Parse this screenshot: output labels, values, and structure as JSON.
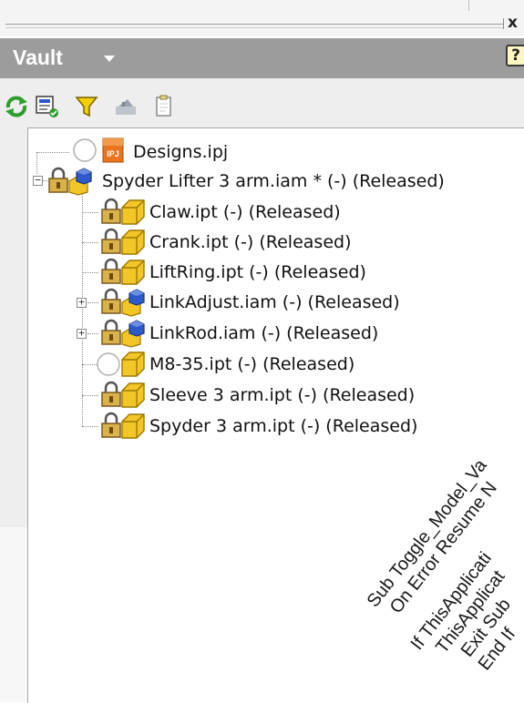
{
  "window": {
    "close_glyph": "x"
  },
  "header": {
    "title": "Vault",
    "help_label": "?"
  },
  "toolbar": {
    "icons": [
      "refresh-icon",
      "check-in-icon",
      "filter-icon",
      "open-drawing-icon",
      "clipboard-icon"
    ]
  },
  "tree": {
    "root_file": {
      "label": "Designs.ipj",
      "badge": "IPJ"
    },
    "assembly": {
      "label": "Spyder Lifter 3 arm.iam * (-) (Released)"
    },
    "children": [
      {
        "label": "Claw.ipt (-) (Released)",
        "kind": "part",
        "locked": true,
        "expandable": false
      },
      {
        "label": "Crank.ipt (-) (Released)",
        "kind": "part",
        "locked": true,
        "expandable": false
      },
      {
        "label": "LiftRing.ipt (-) (Released)",
        "kind": "part",
        "locked": true,
        "expandable": false
      },
      {
        "label": "LinkAdjust.iam (-) (Released)",
        "kind": "assembly",
        "locked": true,
        "expandable": true
      },
      {
        "label": "LinkRod.iam (-) (Released)",
        "kind": "assembly",
        "locked": true,
        "expandable": true
      },
      {
        "label": "M8-35.ipt (-) (Released)",
        "kind": "part",
        "locked": false,
        "expandable": false
      },
      {
        "label": "Sleeve 3 arm.ipt (-) (Released)",
        "kind": "part",
        "locked": true,
        "expandable": false
      },
      {
        "label": "Spyder 3 arm.ipt (-) (Released)",
        "kind": "part",
        "locked": true,
        "expandable": false
      }
    ]
  },
  "overlay_code": {
    "lines": [
      "Sub Toggle_Model_Va",
      "On Error Resume N",
      "If ThisApplicati",
      "ThisApplicat",
      "Exit Sub",
      "End If"
    ]
  },
  "colors": {
    "header_bg": "#9c9c9c",
    "part_yellow": "#f3c628",
    "assembly_blue": "#2e59c9",
    "lock_brown": "#7a5a22"
  }
}
